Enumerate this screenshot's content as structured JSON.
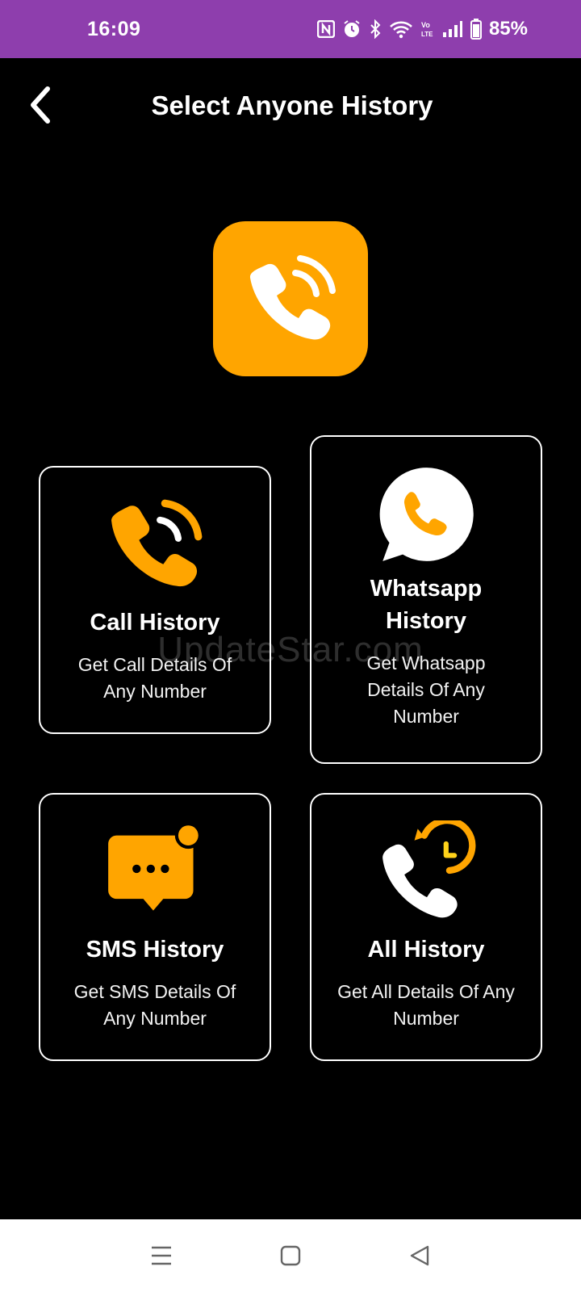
{
  "status_bar": {
    "time": "16:09",
    "battery": "85%",
    "icons": [
      "nfc-icon",
      "alarm-icon",
      "bluetooth-icon",
      "wifi-icon",
      "volte-icon",
      "signal-icon",
      "battery-icon"
    ]
  },
  "header": {
    "title": "Select Anyone History",
    "back_icon": "chevron-left-icon"
  },
  "hero": {
    "icon": "phone-call-icon"
  },
  "cards": [
    {
      "id": "call",
      "icon": "phone-call-icon",
      "title": "Call History",
      "desc_lines": [
        "Get Call Details Of",
        "Any Number"
      ]
    },
    {
      "id": "whatsapp",
      "icon": "whatsapp-icon",
      "title_lines": [
        "Whatsapp",
        "History"
      ],
      "desc_lines": [
        "Get Whatsapp",
        "Details Of Any",
        "Number"
      ]
    },
    {
      "id": "sms",
      "icon": "chat-bubble-icon",
      "title": "SMS History",
      "desc_lines": [
        "Get SMS Details Of",
        "Any Number"
      ]
    },
    {
      "id": "all",
      "icon": "call-history-icon",
      "title": "All History",
      "desc_lines": [
        "Get All Details Of Any",
        "Number"
      ]
    }
  ],
  "watermark": "UpdateStar.com",
  "nav": {
    "icons": [
      "menu-icon",
      "home-icon",
      "back-icon"
    ]
  },
  "colors": {
    "accent": "#ffa500",
    "status_bar": "#8e3ead",
    "background": "#000000"
  }
}
